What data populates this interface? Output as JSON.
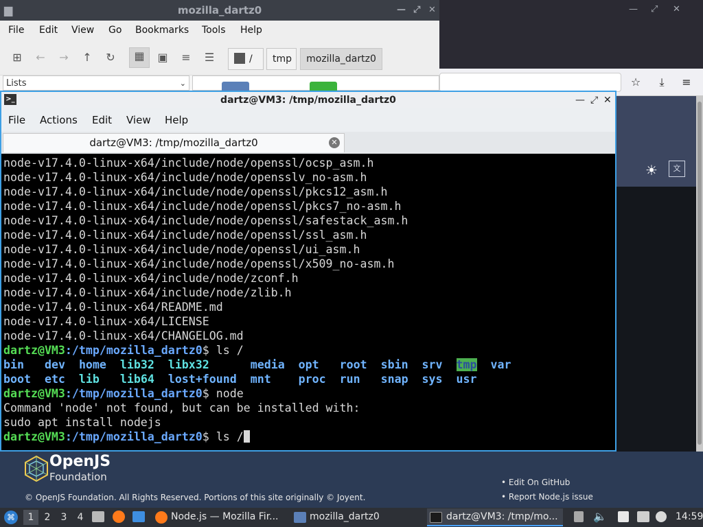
{
  "file_manager": {
    "title": "mozilla_dartz0",
    "menu": [
      "File",
      "Edit",
      "View",
      "Go",
      "Bookmarks",
      "Tools",
      "Help"
    ],
    "path": [
      "/",
      "tmp",
      "mozilla_dartz0"
    ],
    "side_pane": "Lists"
  },
  "terminal": {
    "title": "dartz@VM3: /tmp/mozilla_dartz0",
    "menu": [
      "File",
      "Actions",
      "Edit",
      "View",
      "Help"
    ],
    "tab_label": "dartz@VM3: /tmp/mozilla_dartz0",
    "output_lines": [
      "node-v17.4.0-linux-x64/include/node/openssl/ocsp_asm.h",
      "node-v17.4.0-linux-x64/include/node/opensslv_no-asm.h",
      "node-v17.4.0-linux-x64/include/node/openssl/pkcs12_asm.h",
      "node-v17.4.0-linux-x64/include/node/openssl/pkcs7_no-asm.h",
      "node-v17.4.0-linux-x64/include/node/openssl/safestack_asm.h",
      "node-v17.4.0-linux-x64/include/node/openssl/ssl_asm.h",
      "node-v17.4.0-linux-x64/include/node/openssl/ui_asm.h",
      "node-v17.4.0-linux-x64/include/node/openssl/x509_no-asm.h",
      "node-v17.4.0-linux-x64/include/node/zconf.h",
      "node-v17.4.0-linux-x64/include/node/zlib.h",
      "node-v17.4.0-linux-x64/README.md",
      "node-v17.4.0-linux-x64/LICENSE",
      "node-v17.4.0-linux-x64/CHANGELOG.md"
    ],
    "prompt_user": "dartz@VM3",
    "prompt_path": ":/tmp/mozilla_dartz0",
    "prompt_sign": "$ ",
    "cmd1": "ls /",
    "ls_row1": [
      "bin",
      "dev",
      "home",
      "lib32",
      "libx32",
      "media",
      "opt",
      "root",
      "sbin",
      "srv",
      "tmp",
      "var"
    ],
    "ls_row2": [
      "boot",
      "etc",
      "lib",
      "lib64",
      "lost+found",
      "mnt",
      "proc",
      "run",
      "snap",
      "sys",
      "usr"
    ],
    "cmd2": "node",
    "err1": "Command 'node' not found, but can be installed with:",
    "err2": "sudo apt install nodejs",
    "cmd3": "ls /"
  },
  "browser_page": {
    "brand_top": "OpenJS",
    "brand_bottom": "Foundation",
    "copyright": "© OpenJS Foundation. All Rights Reserved. Portions of this site originally © Joyent.",
    "links": [
      "Edit On GitHub",
      "Report Node.js issue"
    ]
  },
  "taskbar": {
    "workspaces": [
      "1",
      "2",
      "3",
      "4"
    ],
    "tasks": [
      "Node.js — Mozilla Fir...",
      "mozilla_dartz0",
      "dartz@VM3: /tmp/mo..."
    ],
    "clock": "14:59"
  }
}
